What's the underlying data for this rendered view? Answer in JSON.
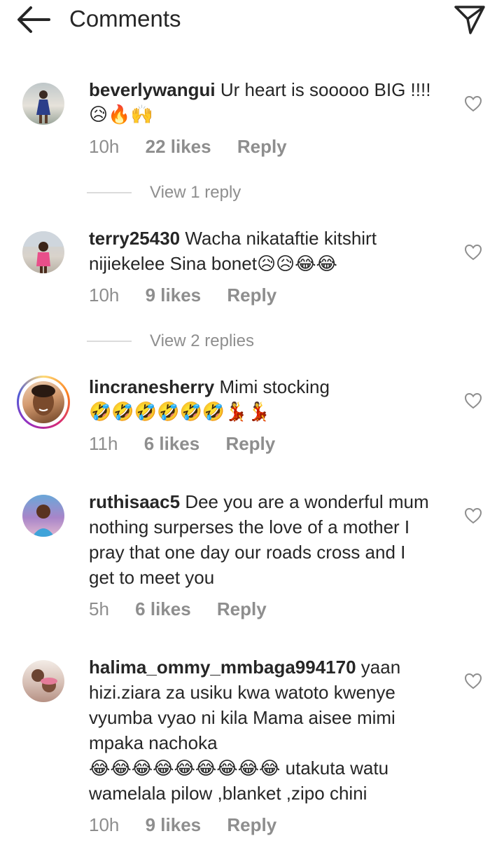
{
  "header": {
    "title": "Comments"
  },
  "comments": [
    {
      "username": "beverlywangui",
      "lines": [
        "Ur heart is sooooo BIG !!!!",
        "😥🔥🙌"
      ],
      "time": "10h",
      "likes": "22 likes",
      "reply": "Reply",
      "view_replies": "View 1 reply"
    },
    {
      "username": "terry25430",
      "lines": [
        "Wacha nikataftie kitshirt",
        "nijiekelee Sina bonet😥😥😂😂"
      ],
      "time": "10h",
      "likes": "9 likes",
      "reply": "Reply",
      "view_replies": "View 2 replies"
    },
    {
      "username": "lincranesherry",
      "lines": [
        "Mimi stocking",
        "🤣🤣🤣🤣🤣🤣💃💃"
      ],
      "time": "11h",
      "likes": "6 likes",
      "reply": "Reply"
    },
    {
      "username": "ruthisaac5",
      "lines": [
        "Dee you are a wonderful mum",
        "nothing surperses the love of a mother I",
        "pray that one day our roads cross and I",
        "get to meet you"
      ],
      "time": "5h",
      "likes": "6 likes",
      "reply": "Reply"
    },
    {
      "username": "halima_ommy_mmbaga994170",
      "lines": [
        "yaan",
        "hizi.ziara za usiku kwa watoto kwenye",
        "vyumba vyao ni kila Mama aisee mimi",
        "mpaka nachoka",
        "😂😂😂😂😂😂😂😂😂 utakuta watu",
        "wamelala  pilow ,blanket ,zipo chini"
      ],
      "time": "10h",
      "likes": "9 likes",
      "reply": "Reply"
    }
  ],
  "icons": {
    "back": "arrow-left-icon",
    "share": "send-icon",
    "like": "heart-outline-icon"
  },
  "colors": {
    "text": "#262626",
    "secondary": "#8e8e8e",
    "divider": "#dbdbdb"
  }
}
